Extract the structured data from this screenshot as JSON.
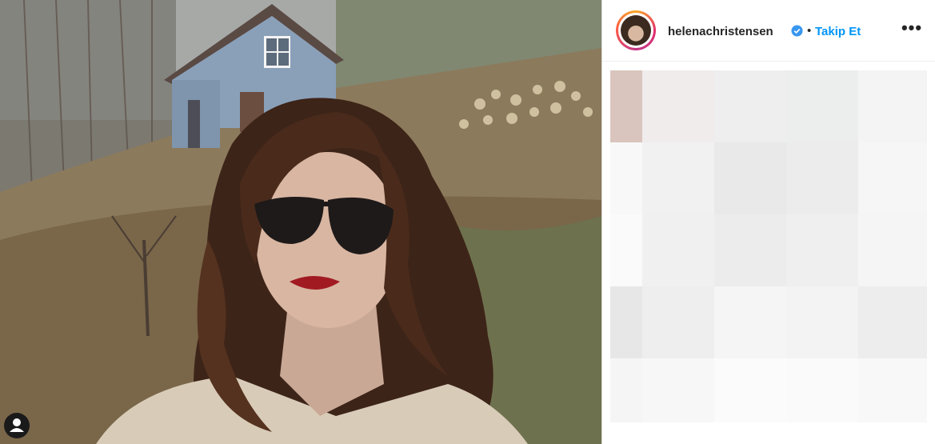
{
  "post": {
    "author": {
      "username": "helenachristensen",
      "verified": true,
      "follow_label": "Takip Et",
      "separator": "•"
    },
    "more_icon": "more-horizontal-icon",
    "more_label": "•••",
    "photo": {
      "subject": "woman in sunglasses taking a selfie outdoors",
      "tag_icon": "user-tag-icon"
    }
  },
  "colors": {
    "follow": "#0095f6",
    "verified": "#3897f0",
    "text": "#262626"
  }
}
